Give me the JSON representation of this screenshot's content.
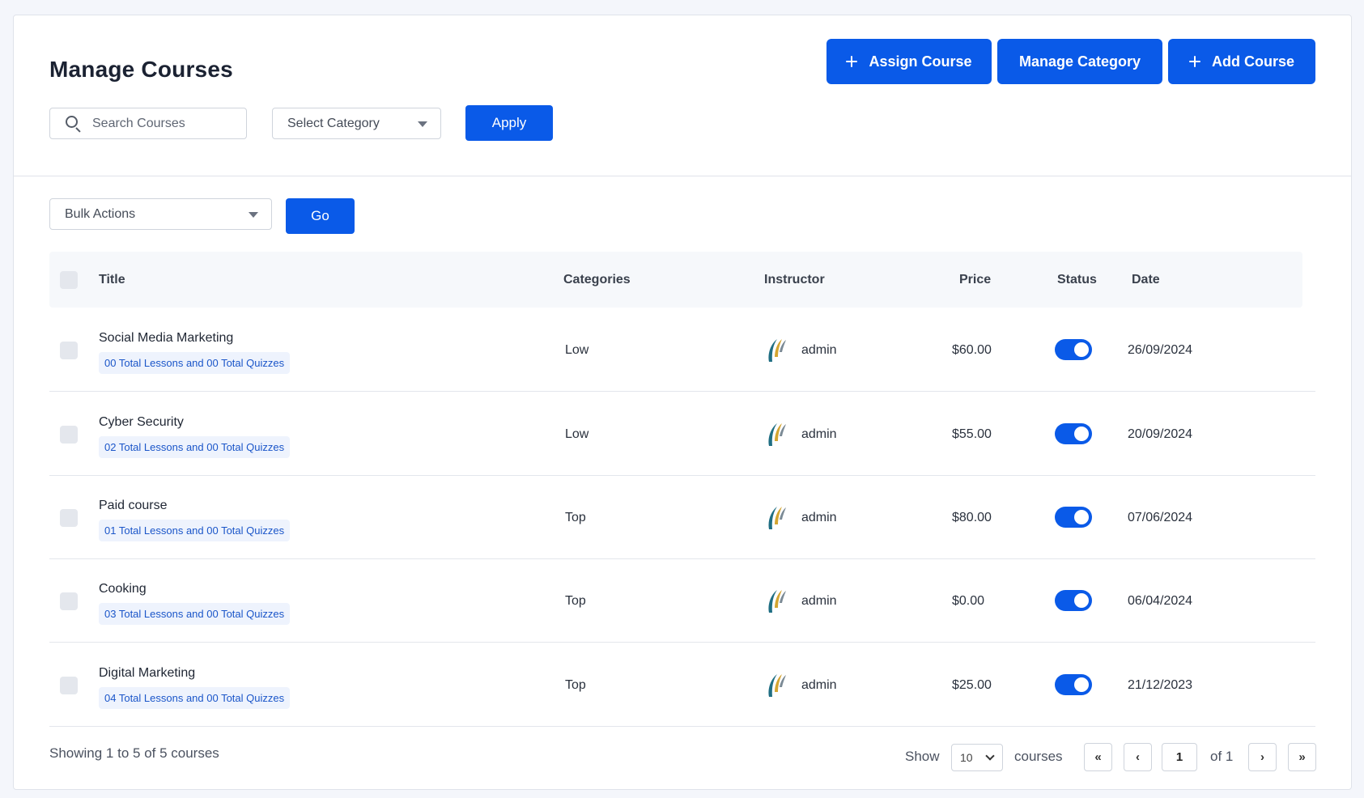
{
  "header": {
    "title": "Manage Courses",
    "assign_label": "Assign Course",
    "category_label": "Manage Category",
    "add_label": "Add Course"
  },
  "filters": {
    "search_placeholder": "Search Courses",
    "category_select": "Select Category",
    "apply_label": "Apply",
    "bulk_select": "Bulk Actions",
    "go_label": "Go"
  },
  "table": {
    "columns": {
      "title": "Title",
      "categories": "Categories",
      "instructor": "Instructor",
      "price": "Price",
      "status": "Status",
      "date": "Date"
    },
    "rows": [
      {
        "title": "Social Media Marketing",
        "meta": "00 Total Lessons and 00 Total Quizzes",
        "category": "Low",
        "instructor": "admin",
        "price": "$60.00",
        "status": "on",
        "date": "26/09/2024"
      },
      {
        "title": "Cyber Security",
        "meta": "02 Total Lessons and 00 Total Quizzes",
        "category": "Low",
        "instructor": "admin",
        "price": "$55.00",
        "status": "on",
        "date": "20/09/2024"
      },
      {
        "title": "Paid course",
        "meta": "01 Total Lessons and 00 Total Quizzes",
        "category": "Top",
        "instructor": "admin",
        "price": "$80.00",
        "status": "on",
        "date": "07/06/2024"
      },
      {
        "title": "Cooking",
        "meta": "03 Total Lessons and 00 Total Quizzes",
        "category": "Top",
        "instructor": "admin",
        "price": "$0.00",
        "status": "on",
        "date": "06/04/2024"
      },
      {
        "title": "Digital Marketing",
        "meta": "04 Total Lessons and 00 Total Quizzes",
        "category": "Top",
        "instructor": "admin",
        "price": "$25.00",
        "status": "on",
        "date": "21/12/2023"
      }
    ]
  },
  "footer": {
    "showing": "Showing 1 to 5 of 5 courses",
    "show_label": "Show",
    "per_page": "10",
    "courses_label": "courses",
    "first": "«",
    "prev": "‹",
    "current_page": "1",
    "of_label": "of 1",
    "next": "›",
    "last": "»"
  },
  "icons": {
    "search": "search-icon",
    "plus": "plus-icon",
    "caret": "caret-down-icon",
    "avatar": "instructor-logo-icon"
  },
  "colors": {
    "primary": "#0a5ae8",
    "badge_bg": "#eef3fd",
    "badge_text": "#1b56c9"
  }
}
